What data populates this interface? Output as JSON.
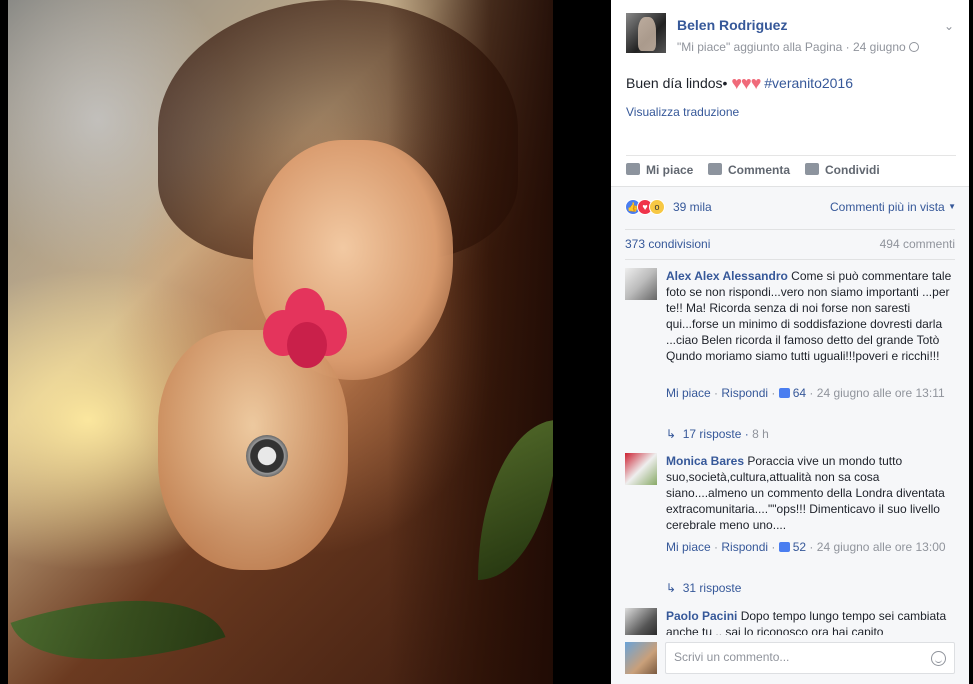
{
  "post": {
    "page_name": "Belen Rodriguez",
    "activity": "\"Mi piace\" aggiunto alla Pagina",
    "date": "24 giugno",
    "separator": " · ",
    "text_before": "Buen día lindos•",
    "hearts": "♥♥♥",
    "hashtag": "#veranito2016",
    "translate_link": "Visualizza traduzione"
  },
  "actions": {
    "like": "Mi piace",
    "comment": "Commenta",
    "share": "Condividi"
  },
  "reactions": {
    "count": "39 mila",
    "sort_label": "Commenti più in vista"
  },
  "stats": {
    "shares": "373 condivisioni",
    "comments": "494 commenti"
  },
  "comments": [
    {
      "author": "Alex Alex Alessandro",
      "text": "Come si può commentare tale foto se non rispondi...vero non siamo importanti ...per te!! Ma! Ricorda senza di noi forse non saresti qui...forse un minimo di soddisfazione dovresti darla ...ciao Belen ricorda il famoso detto del grande Totò Qundo moriamo siamo tutti uguali!!!poveri e ricchi!!!",
      "like_label": "Mi piace",
      "reply_label": "Rispondi",
      "likes": "64",
      "time": "24 giugno alle ore 13:11",
      "replies": "17 risposte",
      "replies_ago": "8 h"
    },
    {
      "author": "Monica Bares",
      "text": "Poraccia vive un mondo tutto suo,società,cultura,attualità non sa cosa siano....almeno un commento della Londra diventata extracomunitaria....\"\"ops!!! Dimenticavo il suo livello cerebrale meno uno....",
      "like_label": "Mi piace",
      "reply_label": "Rispondi",
      "likes": "52",
      "time": "24 giugno alle ore 13:00",
      "replies": "31 risposte"
    },
    {
      "author": "Paolo Pacini",
      "text": "Dopo tempo lungo tempo sei cambiata anche tu .. sai lo riconosco ora hai capito"
    }
  ],
  "composer": {
    "placeholder": "Scrivi un commento..."
  },
  "colors": {
    "link": "#365899",
    "muted": "#90949c",
    "text": "#1d2129",
    "panel_bg": "#f6f7f9"
  }
}
